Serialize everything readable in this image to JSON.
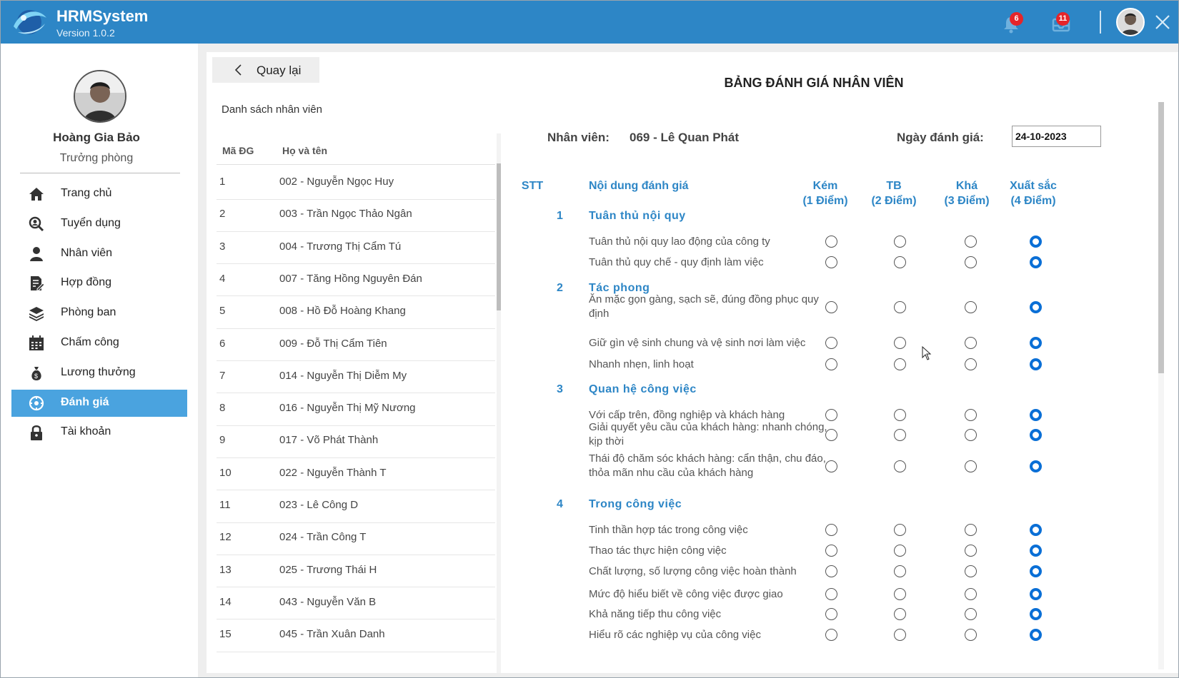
{
  "app": {
    "name": "HRMSystem",
    "version": "Version 1.0.2",
    "notifications_count": "6",
    "messages_count": "11",
    "brand_color": "#2d86c6",
    "active_color": "#4aa3df",
    "selected_radio_color": "#0a6fd6"
  },
  "user": {
    "name": "Hoàng Gia Bảo",
    "role": "Trưởng phòng"
  },
  "menu": [
    {
      "label": "Trang chủ",
      "icon": "home-icon",
      "active": false
    },
    {
      "label": "Tuyển dụng",
      "icon": "search-user-icon",
      "active": false
    },
    {
      "label": "Nhân viên",
      "icon": "person-icon",
      "active": false
    },
    {
      "label": "Hợp đồng",
      "icon": "contract-icon",
      "active": false
    },
    {
      "label": "Phòng ban",
      "icon": "layers-icon",
      "active": false
    },
    {
      "label": "Chấm công",
      "icon": "calendar-icon",
      "active": false
    },
    {
      "label": "Lương thưởng",
      "icon": "money-bag-icon",
      "active": false
    },
    {
      "label": "Đánh giá",
      "icon": "evaluation-icon",
      "active": true
    },
    {
      "label": "Tài khoản",
      "icon": "lock-icon",
      "active": false
    }
  ],
  "back_label": "Quay lại",
  "employee_list": {
    "title": "Danh sách nhân viên",
    "headers": {
      "id": "Mã ĐG",
      "name": "Họ và tên"
    },
    "rows": [
      {
        "id": "1",
        "name": "002 - Nguyễn Ngọc Huy"
      },
      {
        "id": "2",
        "name": "003 - Trần Ngọc Thảo Ngân"
      },
      {
        "id": "3",
        "name": "004 - Trương Thị Cẩm Tú"
      },
      {
        "id": "4",
        "name": "007 - Tăng Hồng Nguyên Đán"
      },
      {
        "id": "5",
        "name": "008 - Hồ Đỗ Hoàng Khang"
      },
      {
        "id": "6",
        "name": "009 - Đỗ Thị Cẩm Tiên"
      },
      {
        "id": "7",
        "name": "014 - Nguyễn Thị Diễm My"
      },
      {
        "id": "8",
        "name": "016 - Nguyễn Thị Mỹ Nương"
      },
      {
        "id": "9",
        "name": "017 - Võ Phát Thành"
      },
      {
        "id": "10",
        "name": "022 - Nguyễn Thành T"
      },
      {
        "id": "11",
        "name": "023 - Lê Công D"
      },
      {
        "id": "12",
        "name": "024 - Trần Công T"
      },
      {
        "id": "13",
        "name": "025 - Trương Thái H"
      },
      {
        "id": "14",
        "name": "043 - Nguyễn Văn B"
      },
      {
        "id": "15",
        "name": "045 - Trần Xuân Danh"
      }
    ]
  },
  "form": {
    "title": "BẢNG ĐÁNH GIÁ NHÂN VIÊN",
    "employee_label": "Nhân viên:",
    "employee_value": "069 - Lê Quan Phát",
    "date_label": "Ngày đánh giá:",
    "date_value": "24-10-2023",
    "col_stt": "STT",
    "col_content": "Nội dung đánh giá",
    "ratings": [
      {
        "name": "Kém",
        "points": "(1 Điểm)"
      },
      {
        "name": "TB",
        "points": "(2 Điểm)"
      },
      {
        "name": "Khá",
        "points": "(3 Điểm)"
      },
      {
        "name": "Xuất sắc",
        "points": "(4 Điểm)"
      }
    ],
    "sections": [
      {
        "num": "1",
        "title": "Tuân thủ nội quy"
      },
      {
        "num": "2",
        "title": "Tác phong"
      },
      {
        "num": "3",
        "title": "Quan hệ công việc"
      },
      {
        "num": "4",
        "title": "Trong công việc"
      }
    ],
    "criteria": [
      {
        "text": "Tuân thủ nội quy lao động của công ty",
        "selected": 4
      },
      {
        "text": "Tuân thủ quy chế - quy định làm việc",
        "selected": 4
      },
      {
        "text": "Ăn mặc gọn gàng, sạch sẽ, đúng đồng phục quy định",
        "selected": 4
      },
      {
        "text": "Giữ gìn vệ sinh chung và vệ sinh nơi làm việc",
        "selected": 4
      },
      {
        "text": "Nhanh nhẹn, linh hoạt",
        "selected": 4
      },
      {
        "text": "Với cấp trên, đồng nghiệp và khách hàng",
        "selected": 4
      },
      {
        "text": "Giải quyết yêu cầu của khách hàng: nhanh chóng, kịp thời",
        "selected": 4
      },
      {
        "text": "Thái độ chăm sóc khách hàng: cẩn thận, chu đáo, thỏa mãn nhu cầu của khách hàng",
        "selected": 4
      },
      {
        "text": "Tinh thần hợp tác trong công việc",
        "selected": 4
      },
      {
        "text": "Thao tác thực hiện công việc",
        "selected": 4
      },
      {
        "text": "Chất lượng, số lượng công việc hoàn thành",
        "selected": 4
      },
      {
        "text": "Mức độ hiểu biết về công việc được giao",
        "selected": 4
      },
      {
        "text": "Khả năng tiếp thu công việc",
        "selected": 4
      },
      {
        "text": "Hiểu rõ các nghiệp vụ của công việc",
        "selected": 4
      }
    ]
  }
}
